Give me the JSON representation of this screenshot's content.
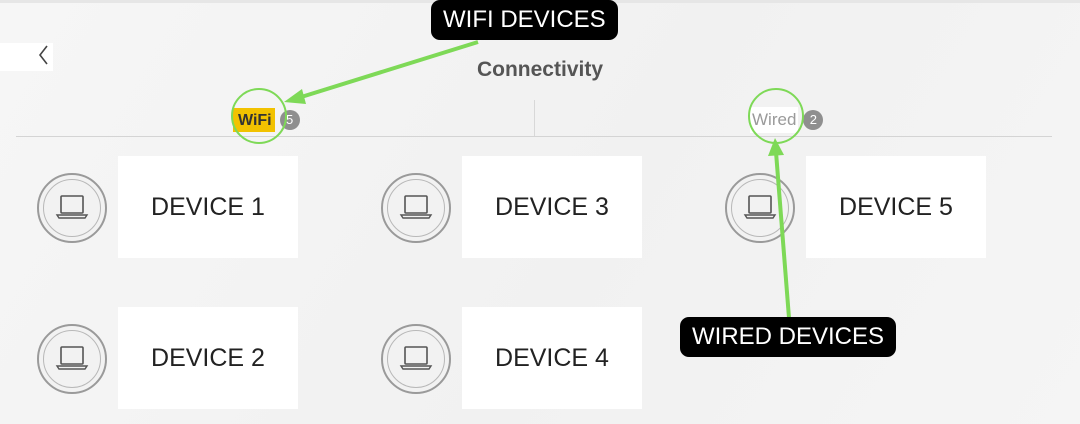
{
  "header": {
    "title": "Connectivity"
  },
  "tabs": [
    {
      "label": "WiFi",
      "count": "5"
    },
    {
      "label": "Wired",
      "count": "2"
    }
  ],
  "devices": [
    {
      "name": "DEVICE 1"
    },
    {
      "name": "DEVICE 2"
    },
    {
      "name": "DEVICE 3"
    },
    {
      "name": "DEVICE 4"
    },
    {
      "name": "DEVICE 5"
    }
  ],
  "annotations": {
    "wifi_label": "WIFI DEVICES",
    "wired_label": "WIRED DEVICES"
  },
  "colors": {
    "accent": "#f2c200",
    "arrow": "#7ed957",
    "badge": "#8f8f8f"
  },
  "icons": {
    "back": "chevron-left-icon",
    "device": "laptop-icon"
  }
}
